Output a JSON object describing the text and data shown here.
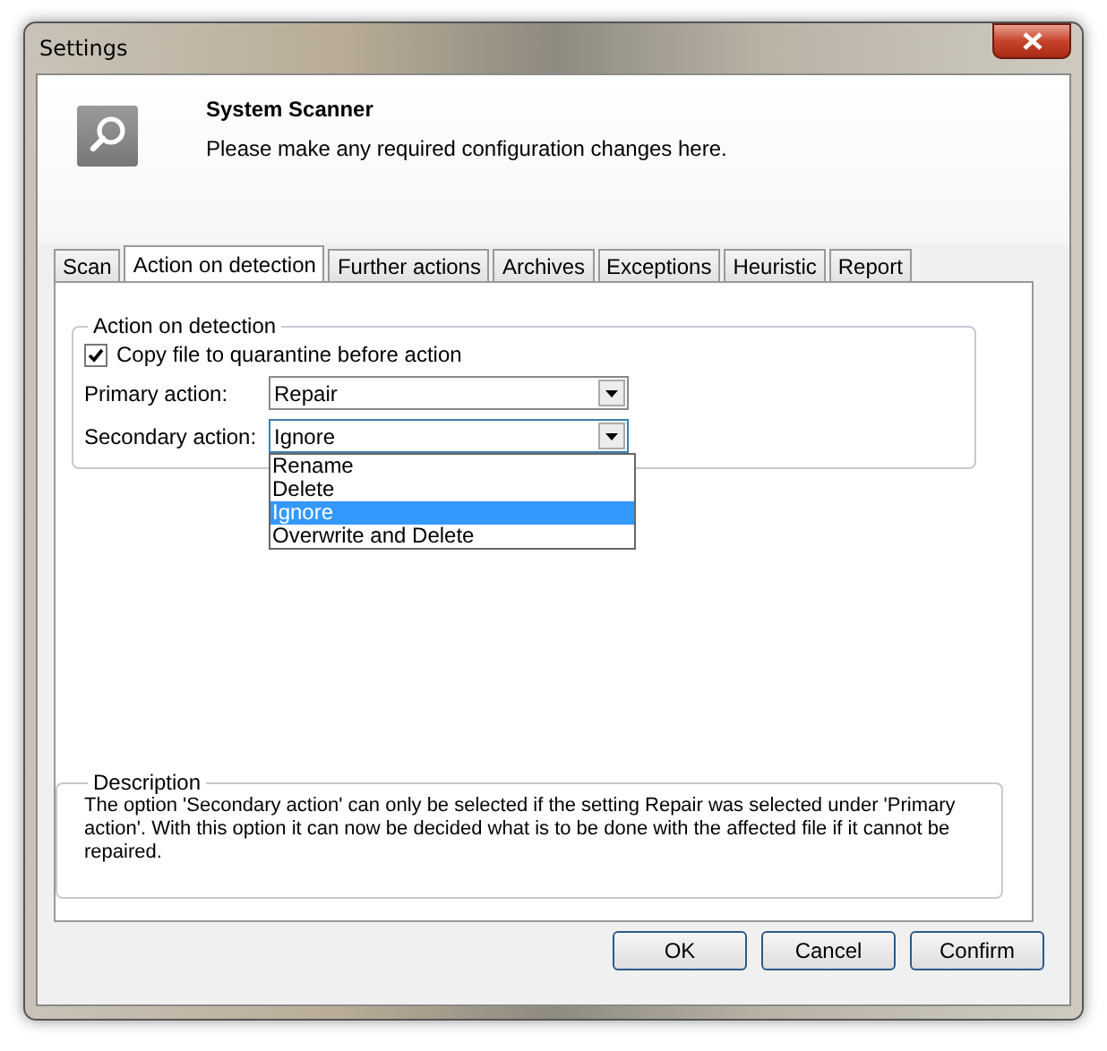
{
  "window": {
    "title": "Settings"
  },
  "header": {
    "title": "System Scanner",
    "subtitle": "Please make any required configuration changes here."
  },
  "tabs": [
    {
      "label": "Scan",
      "selected": false
    },
    {
      "label": "Action on detection",
      "selected": true
    },
    {
      "label": "Further actions",
      "selected": false
    },
    {
      "label": "Archives",
      "selected": false
    },
    {
      "label": "Exceptions",
      "selected": false
    },
    {
      "label": "Heuristic",
      "selected": false
    },
    {
      "label": "Report",
      "selected": false
    }
  ],
  "action_group": {
    "title": "Action on detection",
    "checkbox": {
      "label": "Copy file to quarantine before action",
      "checked": true
    },
    "fields": [
      {
        "label": "Primary action:",
        "value": "Repair",
        "expanded": false
      },
      {
        "label": "Secondary action:",
        "value": "Ignore",
        "expanded": true,
        "options": [
          {
            "label": "Rename",
            "selected": false
          },
          {
            "label": "Delete",
            "selected": false
          },
          {
            "label": "Ignore",
            "selected": true
          },
          {
            "label": "Overwrite and Delete",
            "selected": false
          }
        ]
      }
    ]
  },
  "description": {
    "title": "Description",
    "text": "The option 'Secondary action' can only be selected if the setting Repair was selected under 'Primary action'. With this option it can now be decided what is to be done with the affected file if it cannot be repaired."
  },
  "buttons": [
    "OK",
    "Cancel",
    "Confirm"
  ]
}
